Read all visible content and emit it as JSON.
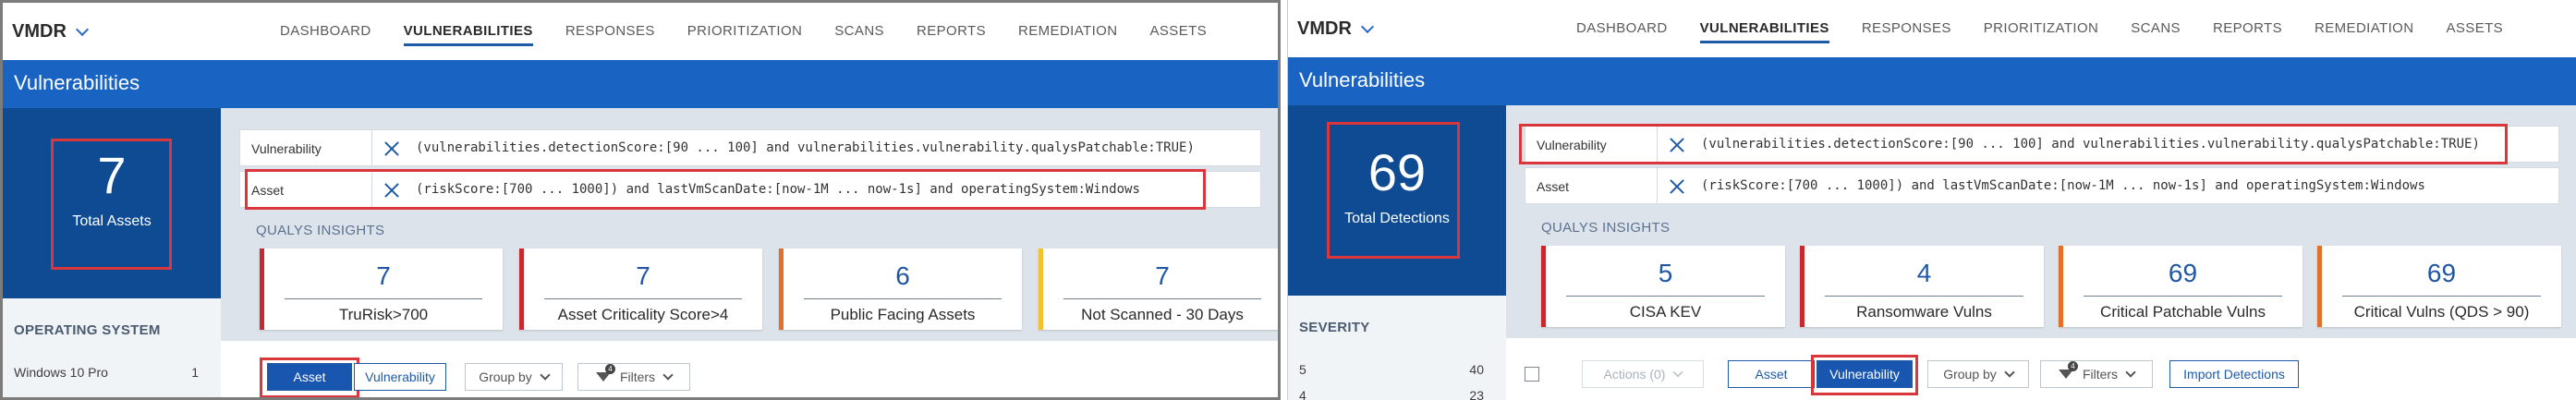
{
  "left": {
    "app_name": "VMDR",
    "nav": [
      "DASHBOARD",
      "VULNERABILITIES",
      "RESPONSES",
      "PRIORITIZATION",
      "SCANS",
      "REPORTS",
      "REMEDIATION",
      "ASSETS"
    ],
    "page_title": "Vulnerabilities",
    "stat": {
      "value": "7",
      "label": "Total Assets"
    },
    "sidebar": {
      "heading": "OPERATING SYSTEM",
      "rows": [
        {
          "name": "Windows 10 Pro",
          "count": "1"
        }
      ]
    },
    "queries": [
      {
        "label": "Vulnerability",
        "text": "(vulnerabilities.detectionScore:[90 ... 100] and vulnerabilities.vulnerability.qualysPatchable:TRUE)"
      },
      {
        "label": "Asset",
        "text": "(riskScore:[700 ... 1000]) and lastVmScanDate:[now-1M ... now-1s] and operatingSystem:Windows"
      }
    ],
    "insights_heading": "QUALYS INSIGHTS",
    "cards": [
      {
        "value": "7",
        "label": "TruRisk>700",
        "color": "#c9282d"
      },
      {
        "value": "7",
        "label": "Asset Criticality Score>4",
        "color": "#c9282d"
      },
      {
        "value": "6",
        "label": "Public Facing Assets",
        "color": "#e0702a"
      },
      {
        "value": "7",
        "label": "Not Scanned - 30 Days",
        "color": "#f2c12e"
      }
    ],
    "toolbar": {
      "asset_tab": "Asset",
      "vulnerability_tab": "Vulnerability",
      "group_by": "Group by",
      "filters": "Filters",
      "filter_count": "4"
    }
  },
  "right": {
    "app_name": "VMDR",
    "nav": [
      "DASHBOARD",
      "VULNERABILITIES",
      "RESPONSES",
      "PRIORITIZATION",
      "SCANS",
      "REPORTS",
      "REMEDIATION",
      "ASSETS"
    ],
    "page_title": "Vulnerabilities",
    "stat": {
      "value": "69",
      "label": "Total Detections"
    },
    "sidebar": {
      "heading": "SEVERITY",
      "rows": [
        {
          "name": "5",
          "count": "40"
        },
        {
          "name": "4",
          "count": "23"
        }
      ]
    },
    "queries": [
      {
        "label": "Vulnerability",
        "text": "(vulnerabilities.detectionScore:[90 ... 100] and vulnerabilities.vulnerability.qualysPatchable:TRUE)"
      },
      {
        "label": "Asset",
        "text": "(riskScore:[700 ... 1000]) and lastVmScanDate:[now-1M ... now-1s] and operatingSystem:Windows"
      }
    ],
    "insights_heading": "QUALYS INSIGHTS",
    "cards": [
      {
        "value": "5",
        "label": "CISA KEV",
        "color": "#c9282d"
      },
      {
        "value": "4",
        "label": "Ransomware Vulns",
        "color": "#c9282d"
      },
      {
        "value": "69",
        "label": "Critical Patchable Vulns",
        "color": "#e0702a"
      },
      {
        "value": "69",
        "label": "Critical Vulns (QDS > 90)",
        "color": "#e0702a"
      }
    ],
    "toolbar": {
      "actions": "Actions (0)",
      "asset_tab": "Asset",
      "vulnerability_tab": "Vulnerability",
      "group_by": "Group by",
      "filters": "Filters",
      "filter_count": "4",
      "import": "Import Detections"
    }
  }
}
